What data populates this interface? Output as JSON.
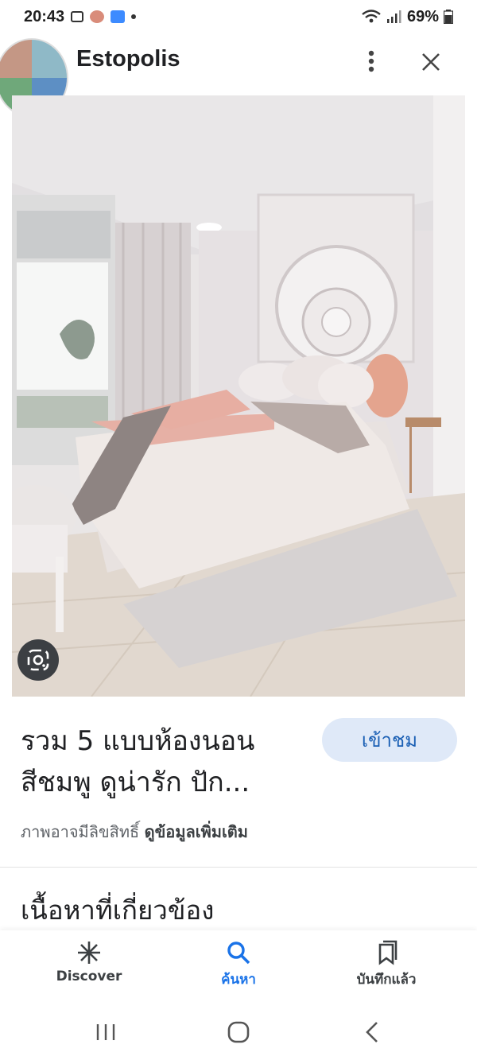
{
  "status_bar": {
    "time": "20:43",
    "battery": "69%"
  },
  "header": {
    "site_name": "Estopolis"
  },
  "result": {
    "title_line1": "รวม 5 แบบห้องนอน",
    "title_line2": "สีชมพู ดูน่ารัก ปัก...",
    "visit_label": "เข้าชม",
    "copyright_text": "ภาพอาจมีลิขสิทธิ์",
    "more_info_link": "ดูข้อมูลเพิ่มเติม"
  },
  "related": {
    "heading": "เนื้อหาที่เกี่ยวข้อง"
  },
  "bottom_nav": {
    "items": [
      {
        "label": "Discover",
        "icon": "asterisk-icon"
      },
      {
        "label": "ค้นหา",
        "icon": "search-icon"
      },
      {
        "label": "บันทึกแล้ว",
        "icon": "bookmarks-icon"
      }
    ]
  },
  "colors": {
    "accent": "#1a73e8",
    "visit_button_bg": "#dfe9f8"
  }
}
